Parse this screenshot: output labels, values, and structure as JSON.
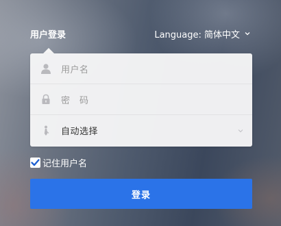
{
  "header": {
    "title": "用户登录",
    "language_label": "Language: 简体中文",
    "language_icon": "chevron-down-icon"
  },
  "form": {
    "username": {
      "placeholder": "用户名",
      "icon": "user-icon"
    },
    "password": {
      "placeholder": "密　码",
      "icon": "lock-icon"
    },
    "mode": {
      "value": "自动选择",
      "icon": "tie-icon",
      "dropdown_icon": "chevron-down-icon"
    }
  },
  "remember": {
    "label": "记住用户名",
    "checked": true
  },
  "login_button": {
    "label": "登录"
  },
  "colors": {
    "accent": "#2b73e8",
    "card": "#f5f5f6",
    "text_light": "#ffffff",
    "placeholder": "#9a9a9a",
    "value": "#333333"
  }
}
